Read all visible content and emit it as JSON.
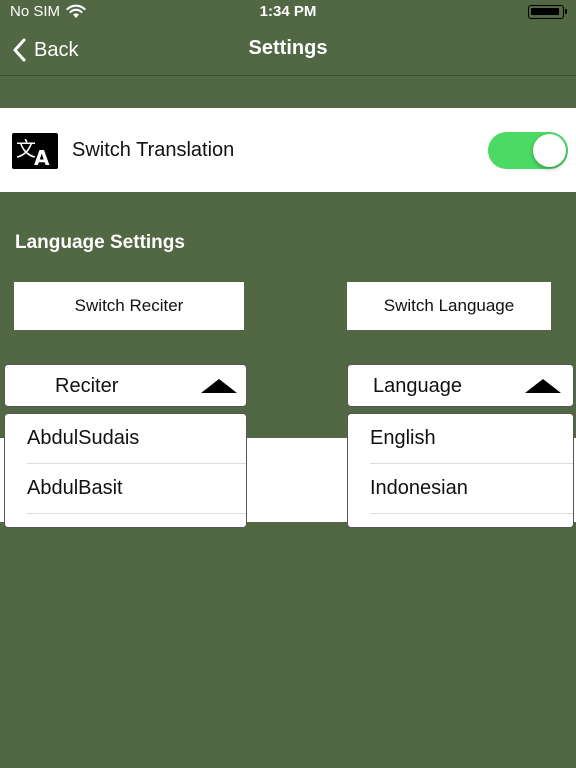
{
  "status_bar": {
    "carrier": "No SIM",
    "time": "1:34 PM"
  },
  "nav": {
    "back_label": "Back",
    "title": "Settings"
  },
  "translation": {
    "label": "Switch Translation",
    "enabled": true,
    "toggle_color": "#4cd964"
  },
  "language_settings": {
    "title": "Language Settings",
    "switch_reciter_label": "Switch Reciter",
    "switch_language_label": "Switch Language",
    "reciter_dropdown": {
      "label": "Reciter",
      "options": [
        "AbdulSudais",
        "AbdulBasit"
      ]
    },
    "language_dropdown": {
      "label": "Language",
      "options": [
        "English",
        "Indonesian"
      ]
    }
  },
  "colors": {
    "background": "#526744",
    "toggle_on": "#4cd964"
  }
}
